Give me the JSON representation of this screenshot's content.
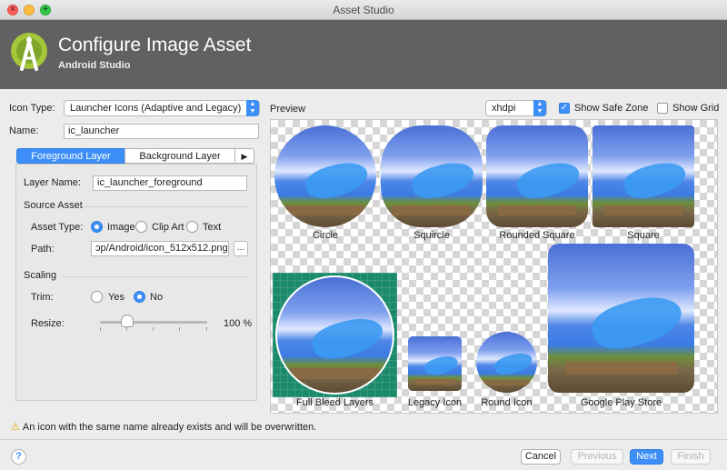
{
  "window": {
    "title": "Asset Studio"
  },
  "header": {
    "title": "Configure Image Asset",
    "subtitle": "Android Studio"
  },
  "form": {
    "icon_type_label": "Icon Type:",
    "icon_type_value": "Launcher Icons (Adaptive and Legacy)",
    "name_label": "Name:",
    "name_value": "ic_launcher"
  },
  "tabs": {
    "foreground": "Foreground Layer",
    "background": "Background Layer",
    "more": "▶"
  },
  "layer": {
    "layer_name_label": "Layer Name:",
    "layer_name_value": "ic_launcher_foreground",
    "source_asset": "Source Asset",
    "asset_type_label": "Asset Type:",
    "asset_types": [
      "Image",
      "Clip Art",
      "Text"
    ],
    "selected_asset_type": "Image",
    "path_label": "Path:",
    "path_value": "ɔp/Android/icon_512x512.png",
    "browse": "...",
    "scaling": "Scaling",
    "trim_label": "Trim:",
    "trim_options": [
      "Yes",
      "No"
    ],
    "trim_selected": "No",
    "resize_label": "Resize:",
    "resize_value": "100 %",
    "resize_level_percent": 100
  },
  "preview": {
    "label": "Preview",
    "density": "xhdpi",
    "show_safe_zone": "Show Safe Zone",
    "show_safe_zone_checked": true,
    "show_grid": "Show Grid",
    "show_grid_checked": false,
    "captions": {
      "circle": "Circle",
      "squircle": "Squircle",
      "rounded": "Rounded Square",
      "square": "Square",
      "bleed": "Full Bleed Layers",
      "legacy": "Legacy Icon",
      "round": "Round Icon",
      "play": "Google Play Store"
    }
  },
  "warning": "An icon with the same name already exists and will be overwritten.",
  "footer": {
    "help": "?",
    "cancel": "Cancel",
    "previous": "Previous",
    "next": "Next",
    "finish": "Finish"
  },
  "colors": {
    "accent": "#3d8ff7",
    "header_bg": "#616161",
    "android_green": "#a4c639"
  }
}
